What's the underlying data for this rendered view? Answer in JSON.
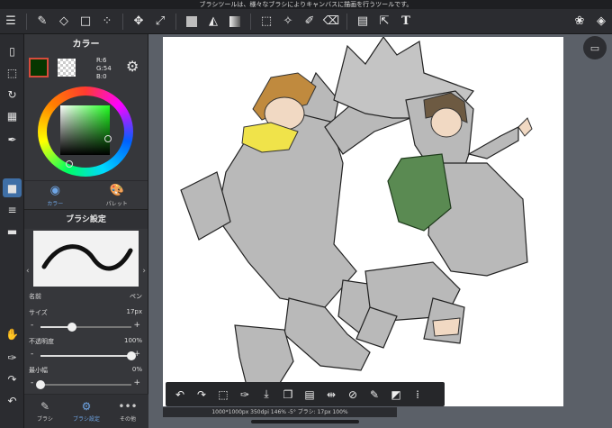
{
  "hint": "ブラシツールは、様々なブラシによりキャンバスに描画を行うツールです。",
  "top_toolbar": {
    "items": [
      "menu-icon",
      "brush-icon",
      "eraser-icon",
      "rect-icon",
      "dotline-icon",
      "move-icon",
      "transform-icon",
      "fill-swatch-icon",
      "bucket-icon",
      "gradient-icon",
      "select-icon",
      "magicwand-icon",
      "selectpen-icon",
      "selecteraser-icon",
      "layout-icon",
      "selectmove-icon",
      "text-icon",
      "materials-icon",
      "layers-icon"
    ],
    "text_label": "T"
  },
  "color_panel": {
    "title": "カラー",
    "main_color": "#063600",
    "rgb": [
      "R:6",
      "G:54",
      "B:0"
    ],
    "tabs": [
      {
        "label": "カラー",
        "active": true
      },
      {
        "label": "パレット",
        "active": false
      }
    ]
  },
  "brush_panel": {
    "title": "ブラシ設定",
    "props": {
      "name_label": "名前",
      "name_value": "ペン",
      "size_label": "サイズ",
      "size_value": "17px",
      "opacity_label": "不透明度",
      "opacity_value": "100%",
      "min_width_label": "最小幅",
      "min_width_value": "0%"
    },
    "size_fraction": 0.35,
    "opacity_fraction": 1.0,
    "min_width_fraction": 0.0
  },
  "bottom_tabs": [
    {
      "label": "ブラシ",
      "active": false
    },
    {
      "label": "ブラシ設定",
      "active": true
    },
    {
      "label": "その他",
      "active": false
    }
  ],
  "status": "1000*1000px 350dpi 146% -5° ブラシ: 17px 100%",
  "accent_color": "#3f6fa6"
}
